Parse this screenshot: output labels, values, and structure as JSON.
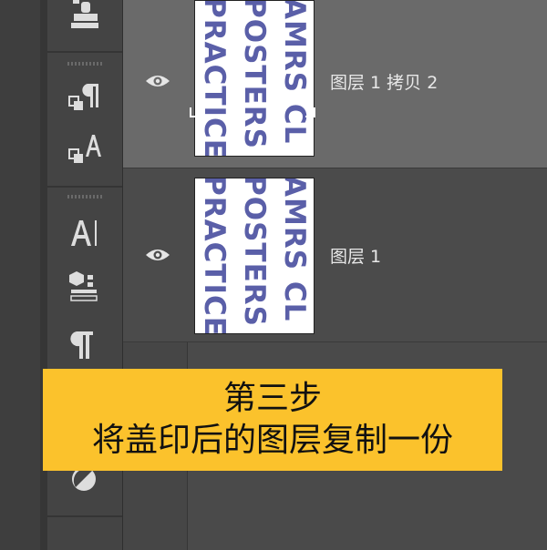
{
  "tools_panel": {
    "icons": [
      "clone-stamp-icon",
      "paragraph-style-icon",
      "character-style-icon",
      "type-tool-icon",
      "3d-material-icon",
      "paragraph-icon",
      "adjustment-icon"
    ]
  },
  "layers": [
    {
      "name": "图层 1 拷贝 2",
      "thumbnail_text": "AMRS CL\nPOSTERS\nPRACTICE",
      "selected": true,
      "visible": true
    },
    {
      "name": "图层 1",
      "thumbnail_text": "AMRS CL\nPOSTERS\nPRACTICE",
      "selected": false,
      "visible": true
    }
  ],
  "caption": {
    "line1": "第三步",
    "line2": "将盖印后的图层复制一份",
    "background": "#fbc22c"
  },
  "colors": {
    "panel_bg": "#474747",
    "selected_row": "#6a6a6a",
    "thumb_text": "#5a5fa8"
  }
}
